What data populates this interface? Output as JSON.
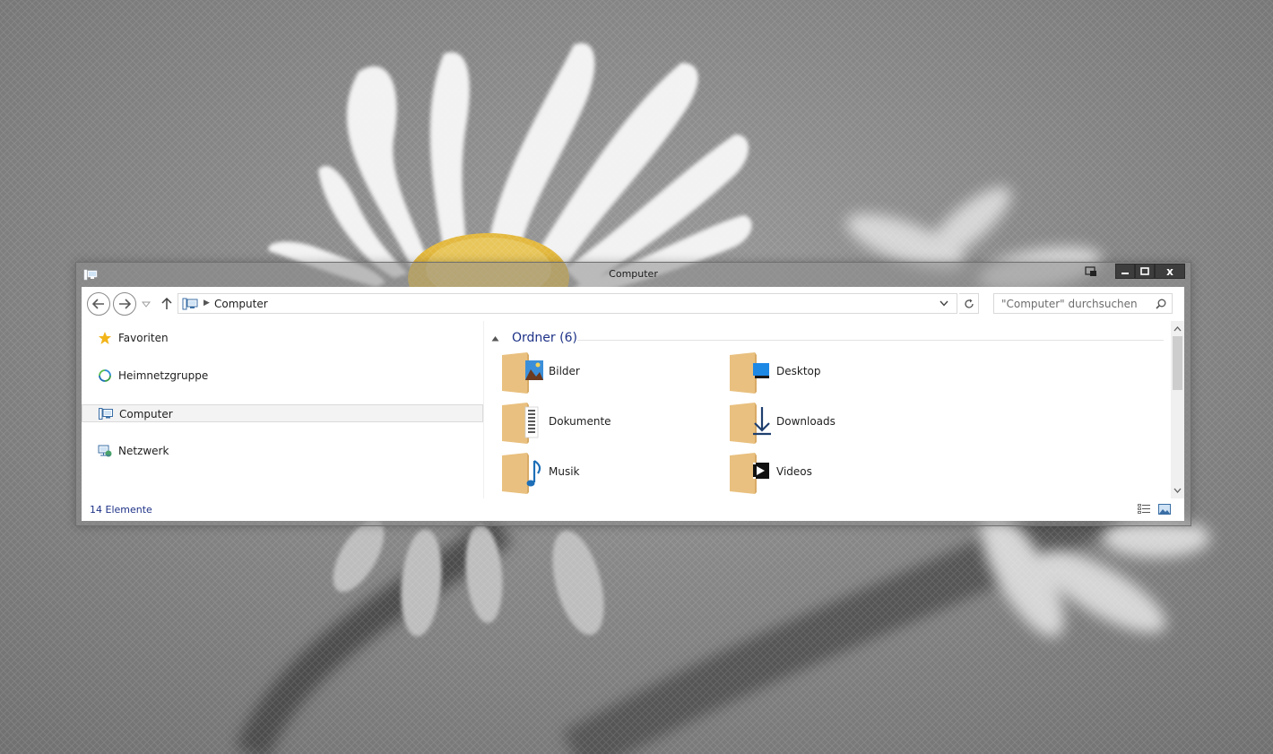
{
  "window": {
    "title": "Computer",
    "close_label": "x"
  },
  "navbar": {
    "address_text": "Computer",
    "search_placeholder": "\"Computer\" durchsuchen"
  },
  "navpane": {
    "items": [
      {
        "label": "Favoriten",
        "icon": "star-icon"
      },
      {
        "label": "Heimnetzgruppe",
        "icon": "homegroup-icon"
      },
      {
        "label": "Computer",
        "icon": "computer-icon",
        "selected": true
      },
      {
        "label": "Netzwerk",
        "icon": "network-icon"
      }
    ]
  },
  "content": {
    "group_title": "Ordner (6)",
    "folders": [
      {
        "label": "Bilder",
        "icon": "pictures-icon"
      },
      {
        "label": "Desktop",
        "icon": "desktop-icon"
      },
      {
        "label": "Dokumente",
        "icon": "documents-icon"
      },
      {
        "label": "Downloads",
        "icon": "downloads-icon"
      },
      {
        "label": "Musik",
        "icon": "music-icon"
      },
      {
        "label": "Videos",
        "icon": "videos-icon"
      }
    ]
  },
  "statusbar": {
    "item_count": "14 Elemente"
  },
  "colors": {
    "accent_text": "#1e3287",
    "folder": "#e9c07f",
    "selection": "#f3f3f3"
  }
}
